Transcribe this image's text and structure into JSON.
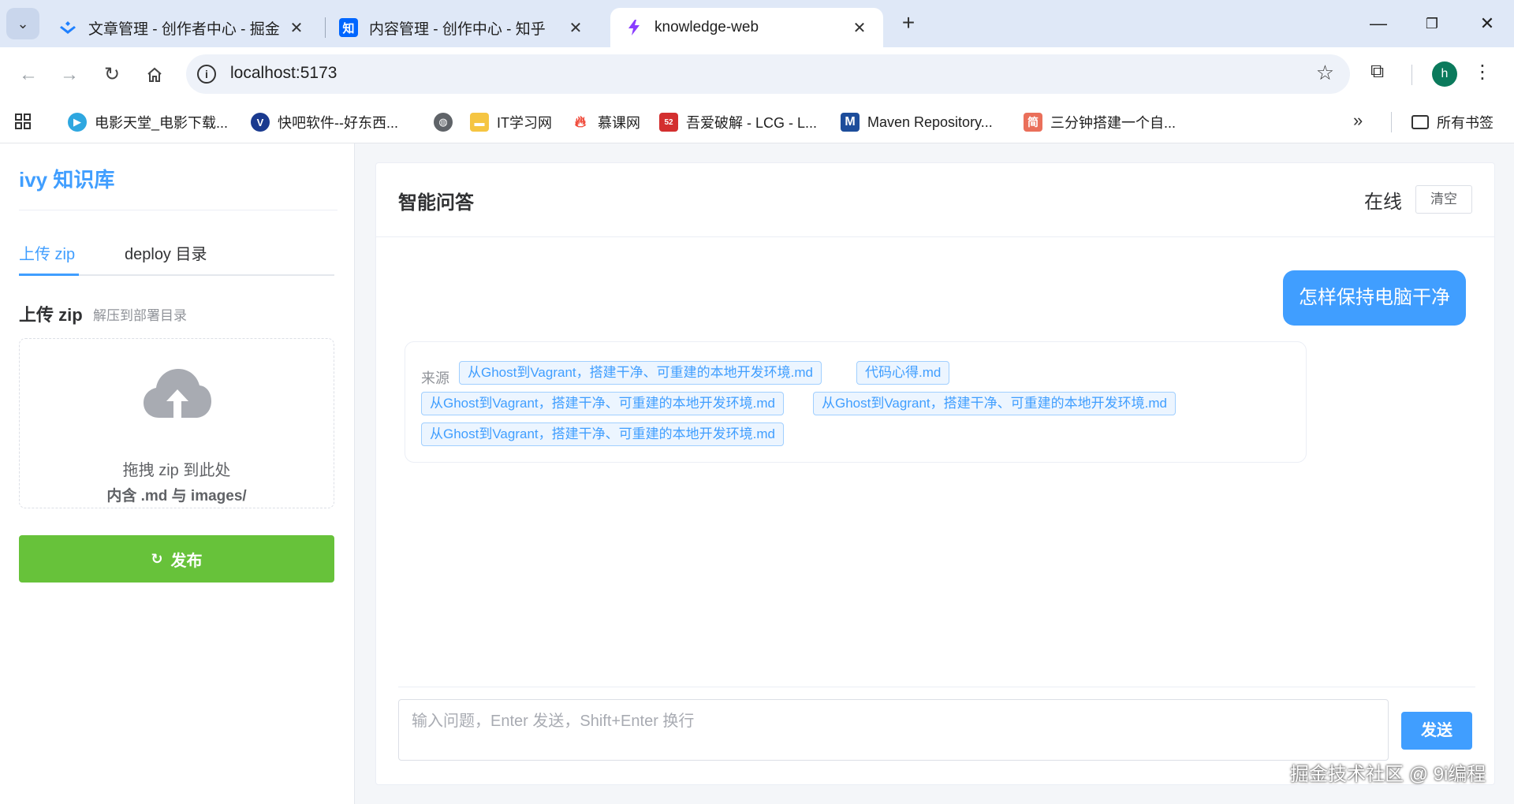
{
  "browser": {
    "tabs": [
      {
        "title": "文章管理 - 创作者中心 - 掘金",
        "icon": "juejin-icon",
        "color": "#1e80ff"
      },
      {
        "title": "内容管理 - 创作中心 - 知乎",
        "icon": "zhihu-icon",
        "icon_text": "知",
        "color": "#0066ff"
      },
      {
        "title": "knowledge-web",
        "icon": "vite-icon",
        "color": "#8a3cff"
      }
    ],
    "url": "localhost:5173",
    "avatar_letter": "h",
    "bookmarks": [
      {
        "label": "电影天堂_电影下载...",
        "icon": "movie-icon",
        "color": "#2ea7e0"
      },
      {
        "label": "快吧软件--好东西...",
        "icon_text": "V",
        "color": "#1a3a8f"
      },
      {
        "label": "",
        "icon": "globe-icon",
        "color": "#5f6368"
      },
      {
        "label": "IT学习网",
        "icon": "folder-icon",
        "color": "#f5c542"
      },
      {
        "label": "慕课网",
        "icon": "flame-icon",
        "color": "#f04a3a"
      },
      {
        "label": "吾爱破解 - LCG - L...",
        "icon_text": "52",
        "color": "#d32f2f"
      },
      {
        "label": "Maven Repository...",
        "icon_text": "M",
        "color": "#1d4d9b"
      },
      {
        "label": "三分钟搭建一个自...",
        "icon_text": "简",
        "color": "#ea6f5a"
      }
    ],
    "all_bookmarks": "所有书签"
  },
  "sidebar": {
    "brand": "ivy 知识库",
    "tabs": [
      "上传 zip",
      "deploy 目录"
    ],
    "upload_title": "上传 zip",
    "upload_subtitle": "解压到部署目录",
    "dropzone_text": "拖拽 zip 到此处",
    "dropzone_hint": "内含 .md 与 images/",
    "publish_label": "发布"
  },
  "chat": {
    "title": "智能问答",
    "status": "在线",
    "clear_label": "清空",
    "user_message": "怎样保持电脑干净",
    "source_label": "来源",
    "sources": [
      "从Ghost到Vagrant，搭建干净、可重建的本地开发环境.md",
      "代码心得.md",
      "从Ghost到Vagrant，搭建干净、可重建的本地开发环境.md",
      "从Ghost到Vagrant，搭建干净、可重建的本地开发环境.md",
      "从Ghost到Vagrant，搭建干净、可重建的本地开发环境.md"
    ],
    "input_placeholder": "输入问题，Enter 发送，Shift+Enter 换行",
    "input_value": "",
    "send_label": "发送"
  },
  "watermark": "掘金技术社区 @ 9i编程",
  "colors": {
    "primary": "#409eff",
    "success": "#67c23a",
    "chrome_tabbar": "#dfe8f7"
  }
}
